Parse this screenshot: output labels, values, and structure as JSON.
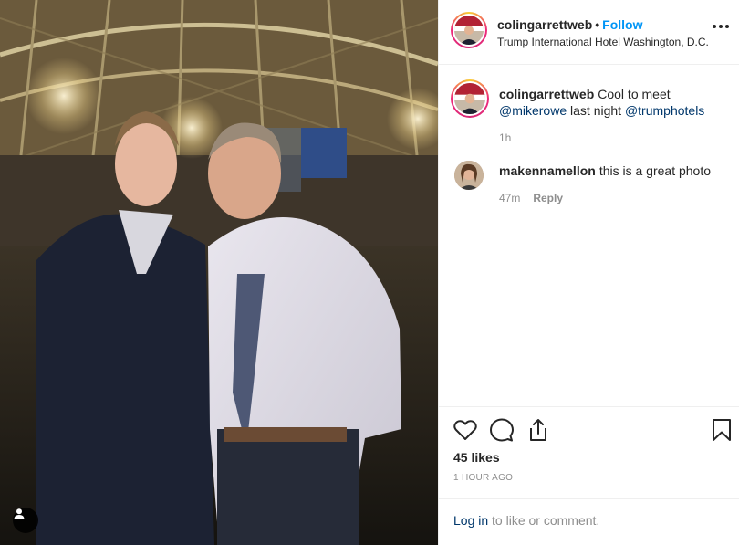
{
  "post": {
    "username": "colingarrettweb",
    "dot": "•",
    "follow_label": "Follow",
    "location": "Trump International Hotel Washington, D.C."
  },
  "comments": [
    {
      "username": "colingarrettweb",
      "text_pre": "Cool to meet ",
      "mention1": "@mikerowe",
      "text_mid": " last night ",
      "mention2": "@trumphotels",
      "time": "1h"
    },
    {
      "username": "makennamellon",
      "text": "this is a great photo",
      "time": "47m",
      "reply_label": "Reply"
    }
  ],
  "actions": {
    "icons": [
      "heart-icon",
      "comment-icon",
      "share-icon",
      "bookmark-icon"
    ],
    "likes": "45 likes",
    "timestamp": "1 HOUR AGO"
  },
  "login": {
    "link_label": "Log in",
    "rest": " to like or comment."
  },
  "colors": {
    "link_blue": "#0095f6",
    "mention_blue": "#00376b",
    "meta_gray": "#8e8e8e"
  }
}
